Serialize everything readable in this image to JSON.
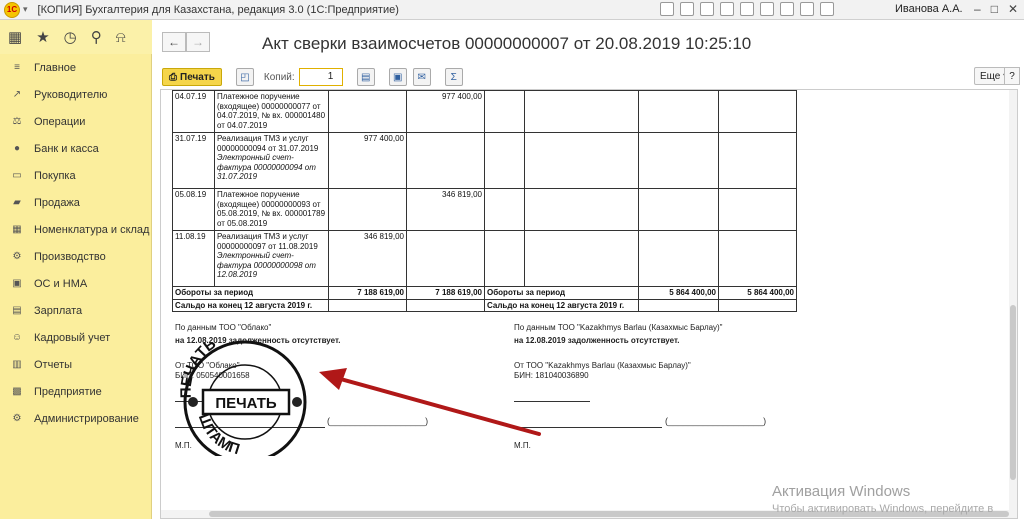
{
  "window": {
    "title": "[КОПИЯ] Бухгалтерия для Казахстана, редакция 3.0  (1С:Предприятие)",
    "user": "Иванова А.А.",
    "logo": "1С"
  },
  "sidebar": {
    "items": [
      {
        "label": "Главное",
        "icon": "menu-icon"
      },
      {
        "label": "Руководителю",
        "icon": "chart-icon"
      },
      {
        "label": "Операции",
        "icon": "operations-icon"
      },
      {
        "label": "Банк и касса",
        "icon": "bank-icon"
      },
      {
        "label": "Покупка",
        "icon": "cart-icon"
      },
      {
        "label": "Продажа",
        "icon": "sale-icon"
      },
      {
        "label": "Номенклатура и склад",
        "icon": "warehouse-icon"
      },
      {
        "label": "Производство",
        "icon": "production-icon"
      },
      {
        "label": "ОС и НМА",
        "icon": "assets-icon"
      },
      {
        "label": "Зарплата",
        "icon": "salary-icon"
      },
      {
        "label": "Кадровый учет",
        "icon": "staff-icon"
      },
      {
        "label": "Отчеты",
        "icon": "reports-icon"
      },
      {
        "label": "Предприятие",
        "icon": "enterprise-icon"
      },
      {
        "label": "Администрирование",
        "icon": "admin-icon"
      }
    ]
  },
  "document": {
    "title": "Акт сверки взаимосчетов 00000000007 от 20.08.2019 10:25:10",
    "toolbar": {
      "print_label": "Печать",
      "copies_label": "Копий:",
      "copies_value": "1",
      "more_label": "Еще",
      "help_label": "?"
    }
  },
  "table": {
    "rows": [
      {
        "date": "04.07.19",
        "desc": "Платежное поручение (входящее) 00000000077 от 04.07.2019,  № вх. 000001480 от 04.07.2019",
        "desc_italic": "",
        "debit": "",
        "credit": "977 400,00"
      },
      {
        "date": "31.07.19",
        "desc": "Реализация ТМЗ и услуг 00000000094 от 31.07.2019",
        "desc_italic": "Электронный счет-фактура 00000000094 от 31.07.2019",
        "debit": "977 400,00",
        "credit": ""
      },
      {
        "date": "05.08.19",
        "desc": "Платежное поручение (входящее) 00000000093 от 05.08.2019,  № вх. 000001789 от 05.08.2019",
        "desc_italic": "",
        "debit": "",
        "credit": "346 819,00"
      },
      {
        "date": "11.08.19",
        "desc": "Реализация ТМЗ и услуг 00000000097 от 11.08.2019",
        "desc_italic": "Электронный счет-фактура 00000000098 от 12.08.2019",
        "debit": "346 819,00",
        "credit": ""
      }
    ],
    "totals_label": "Обороты за период",
    "totals_debit": "7 188 619,00",
    "totals_credit": "7 188 619,00",
    "totals_label_right": "Обороты за период",
    "totals_debit_right": "5 864 400,00",
    "totals_credit_right": "5 864 400,00",
    "saldo_label": "Сальдо на конец 12 августа 2019 г.",
    "saldo_label_right": "Сальдо на конец 12 августа 2019 г."
  },
  "signatures": {
    "left_line1": "По данным ТОО \"Облако\"",
    "left_line2": "на 12.08.2019 задолженность отсутствует.",
    "left_from": "От ТОО \"Облако\"",
    "left_bin": "БИН: 050540001658",
    "left_mp": "М.П.",
    "right_line1": "По данным ТОО \"Kazakhmys Barlau (Казахмыс Барлау)\"",
    "right_line2": "на 12.08.2019 задолженность отсутствует.",
    "right_from": "От ТОО \"Kazakhmys Barlau (Казахмыс Барлау)\"",
    "right_bin": "БИН: 181040036890",
    "right_mp": "М.П."
  },
  "stamp": {
    "center": "ПЕЧАТЬ",
    "top_arc": "ПЕЧАТЬ",
    "bottom_arc": "ШТАМП"
  },
  "watermark": {
    "title": "Активация Windows",
    "subtitle": "Чтобы активировать Windows, перейдите в"
  },
  "colors": {
    "sidebar_bg": "#fbee9d",
    "print_button": "#f5d54a",
    "arrow": "#b01818"
  }
}
